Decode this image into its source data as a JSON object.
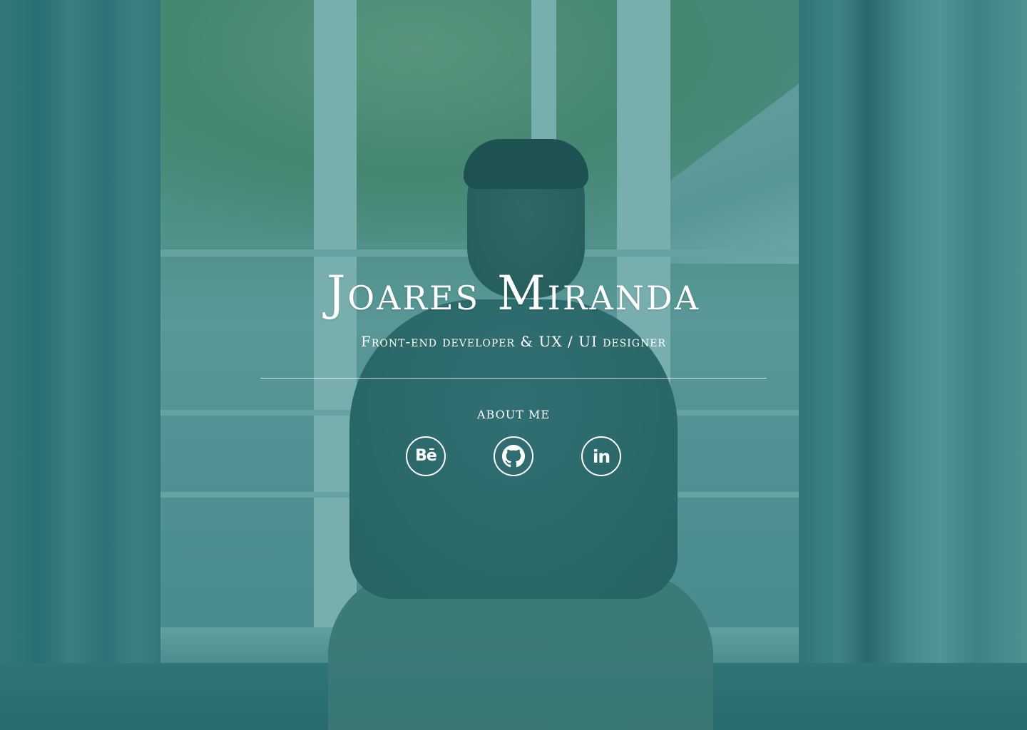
{
  "hero": {
    "name": "Joares Miranda",
    "subtitle": "Front-end developer & UX / UI designer",
    "about_link": "ABOUT ME"
  },
  "social": [
    {
      "icon": "behance-icon",
      "glyph": "Bē"
    },
    {
      "icon": "github-icon"
    },
    {
      "icon": "linkedin-icon",
      "glyph": "in"
    }
  ],
  "colors": {
    "overlay": "#1c787d",
    "text": "#ffffff"
  }
}
